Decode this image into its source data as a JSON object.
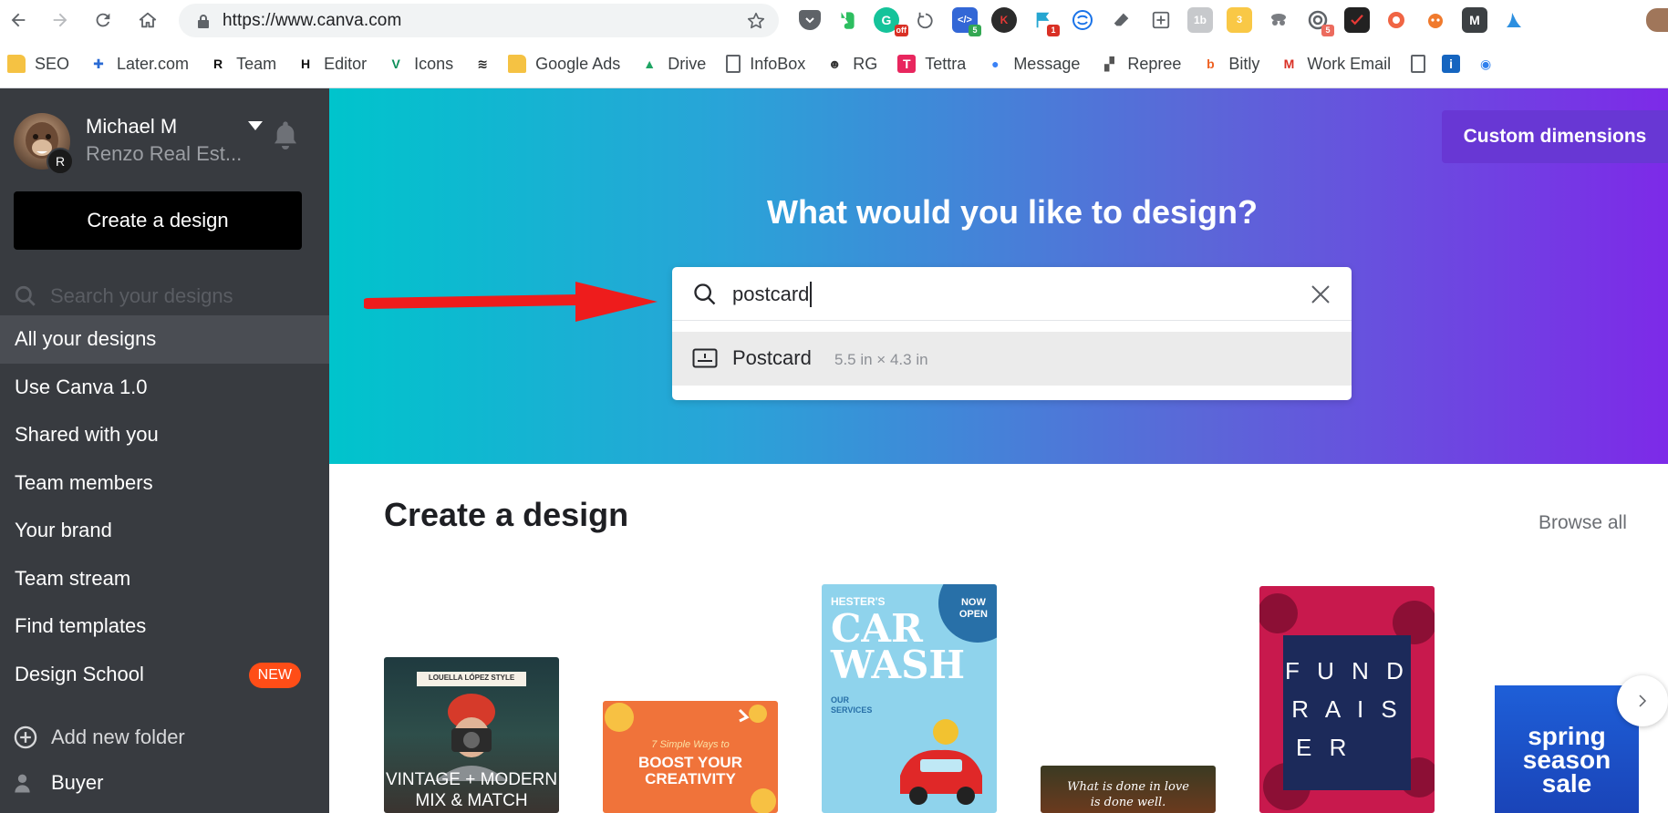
{
  "browser": {
    "url": "https://www.canva.com",
    "extension_badges": {
      "grammarly": "off",
      "code": "5",
      "flag": "1",
      "chain": "5"
    }
  },
  "bookmarks": [
    {
      "label": "SEO",
      "icon": "folder-icon",
      "color": "#f5c243"
    },
    {
      "label": "Later.com",
      "icon": "later-icon",
      "color": "#2a6bd4"
    },
    {
      "label": "Team",
      "icon": "r-logo-icon",
      "color": "#111111"
    },
    {
      "label": "Editor",
      "icon": "h-logo-icon",
      "color": "#111111"
    },
    {
      "label": "Icons",
      "icon": "v-logo-icon",
      "color": "#0c8f5a"
    },
    {
      "label": "",
      "icon": "squarespace-icon",
      "color": "#222222"
    },
    {
      "label": "Google Ads",
      "icon": "folder-icon",
      "color": "#f5c243"
    },
    {
      "label": "Drive",
      "icon": "drive-icon",
      "color": "#1fa463"
    },
    {
      "label": "InfoBox",
      "icon": "page-icon",
      "color": "#5f6368"
    },
    {
      "label": "RG",
      "icon": "rg-icon",
      "color": "#333333"
    },
    {
      "label": "Tettra",
      "icon": "tettra-icon",
      "color": "#e8265e"
    },
    {
      "label": "Message",
      "icon": "message-icon",
      "color": "#3b82f6"
    },
    {
      "label": "Repree",
      "icon": "repree-icon",
      "color": "#555555"
    },
    {
      "label": "Bitly",
      "icon": "bitly-icon",
      "color": "#ee6123"
    },
    {
      "label": "Work Email",
      "icon": "gmail-icon",
      "color": "#d93025"
    },
    {
      "label": "",
      "icon": "page-icon",
      "color": "#5f6368"
    },
    {
      "label": "",
      "icon": "info-icon",
      "color": "#1565c0"
    },
    {
      "label": "",
      "icon": "feed-icon",
      "color": "#2f80ed"
    }
  ],
  "sidebar": {
    "user_name": "Michael M",
    "team_name": "Renzo Real Est...",
    "avatar_badge": "R",
    "create_label": "Create a design",
    "search_placeholder": "Search your designs",
    "nav": [
      "All your designs",
      "Use Canva 1.0",
      "Shared with you",
      "Team members",
      "Your brand",
      "Team stream",
      "Find templates",
      "Design School"
    ],
    "new_badge": "NEW",
    "add_folder": "Add new folder",
    "buyer": "Buyer"
  },
  "hero": {
    "custom_dimensions": "Custom dimensions",
    "title": "What would you like to design?",
    "search_value": "postcard",
    "suggestion_name": "Postcard",
    "suggestion_size": "5.5 in × 4.3 in"
  },
  "section": {
    "title": "Create a design",
    "browse_all": "Browse all"
  },
  "cards": {
    "vintage_header": "LOUELLA LÓPEZ STYLE",
    "vintage_line1": "VINTAGE + MODERN",
    "vintage_line2": "MIX & MATCH",
    "boost_small": "7 Simple Ways to",
    "boost_line1": "BOOST YOUR",
    "boost_line2": "CREATIVITY",
    "carwash_brand": "HESTER'S",
    "carwash_line1": "CAR",
    "carwash_line2": "WASH",
    "carwash_badge_line1": "NOW",
    "carwash_badge_line2": "OPEN",
    "carwash_services": "OUR SERVICES",
    "quote_line1": "What is done in love",
    "quote_line2": "is done well.",
    "fund_line1": "F U N D",
    "fund_line2": "R A I S",
    "fund_line3": "E R",
    "spring_line1": "spring",
    "spring_line2": "season",
    "spring_line3": "sale"
  }
}
